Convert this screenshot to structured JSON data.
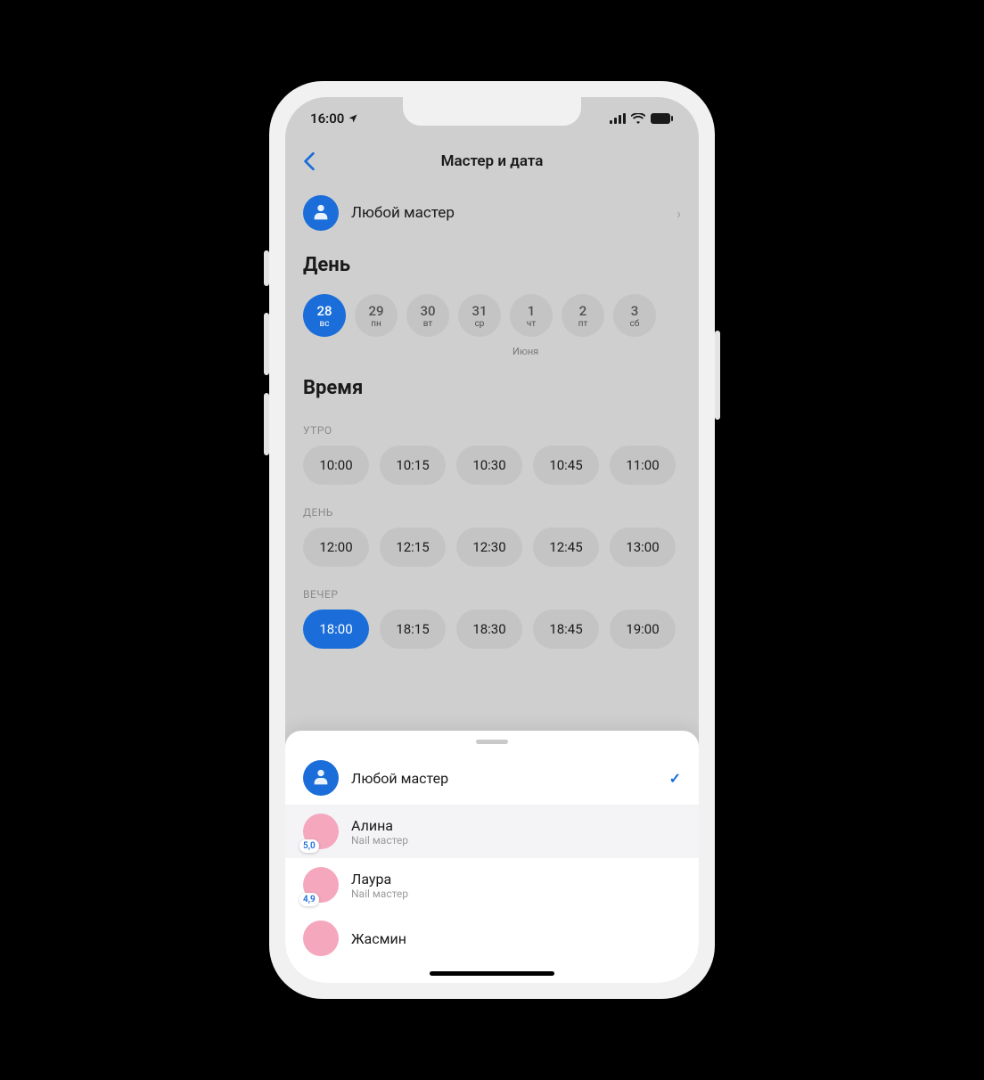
{
  "status": {
    "time": "16:00"
  },
  "nav": {
    "title": "Мастер и дата"
  },
  "master_selector": {
    "label": "Любой мастер"
  },
  "day_section": {
    "title": "День",
    "month_label": "Июня",
    "days": [
      {
        "num": "28",
        "dow": "вс",
        "selected": true
      },
      {
        "num": "29",
        "dow": "пн",
        "selected": false
      },
      {
        "num": "30",
        "dow": "вт",
        "selected": false
      },
      {
        "num": "31",
        "dow": "ср",
        "selected": false
      },
      {
        "num": "1",
        "dow": "чт",
        "selected": false
      },
      {
        "num": "2",
        "dow": "пт",
        "selected": false
      },
      {
        "num": "3",
        "dow": "сб",
        "selected": false
      }
    ]
  },
  "time_section": {
    "title": "Время",
    "groups": [
      {
        "label": "УТРО",
        "times": [
          "10:00",
          "10:15",
          "10:30",
          "10:45",
          "11:00"
        ],
        "selected": null
      },
      {
        "label": "ДЕНЬ",
        "times": [
          "12:00",
          "12:15",
          "12:30",
          "12:45",
          "13:00"
        ],
        "selected": null
      },
      {
        "label": "ВЕЧЕР",
        "times": [
          "18:00",
          "18:15",
          "18:30",
          "18:45",
          "19:00"
        ],
        "selected": "18:00"
      }
    ]
  },
  "sheet": {
    "rows": [
      {
        "name": "Любой мастер",
        "sub": "",
        "rating": "",
        "avatar": "blue",
        "checked": true
      },
      {
        "name": "Алина",
        "sub": "Nail мастер",
        "rating": "5,0",
        "avatar": "pink",
        "checked": false,
        "highlight": true
      },
      {
        "name": "Лаура",
        "sub": "Nail мастер",
        "rating": "4,9",
        "avatar": "pink",
        "checked": false
      },
      {
        "name": "Жасмин",
        "sub": "",
        "rating": "",
        "avatar": "pink",
        "checked": false
      }
    ]
  }
}
